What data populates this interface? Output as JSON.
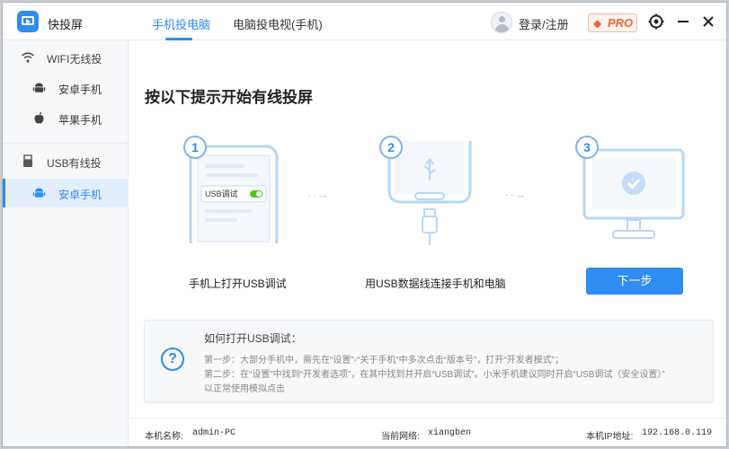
{
  "app": {
    "name": "快投屏"
  },
  "tabs": [
    {
      "label": "手机投电脑"
    },
    {
      "label": "电脑投电视(手机)"
    }
  ],
  "header": {
    "login_label": "登录/注册",
    "pro_label": "PRO"
  },
  "sidebar": {
    "sections": [
      {
        "label": "WIFI无线投",
        "items": [
          {
            "label": "安卓手机"
          },
          {
            "label": "苹果手机"
          }
        ]
      },
      {
        "label": "USB有线投",
        "items": [
          {
            "label": "安卓手机"
          }
        ]
      }
    ]
  },
  "main": {
    "headline": "按以下提示开始有线投屏",
    "steps": [
      {
        "number": "1",
        "caption": "手机上打开USB调试",
        "phone_label": "USB调试"
      },
      {
        "number": "2",
        "caption": "用USB数据线连接手机和电脑"
      },
      {
        "number": "3"
      }
    ],
    "arrow": "··→",
    "next_button": "下一步",
    "help": {
      "icon": "?",
      "title": "如何打开USB调试：",
      "lines": [
        "第一步：大部分手机中，需先在“设置”-“关于手机”中多次点击“版本号”，打开“开发者模式”；",
        "第二步：在“设置”中找到“开发者选项”，在其中找到并开启“USB调试”。小米手机建议同时开启“USB调试（安全设置）”",
        "以正常使用模拟点击"
      ]
    }
  },
  "footer": {
    "pc_name_label": "本机名称:",
    "pc_name_value": "admin-PC",
    "network_label": "当前网络:",
    "network_value": "xiangben",
    "ip_label": "本机IP地址:",
    "ip_value": "192.168.0.119"
  },
  "colors": {
    "accent": "#2f8cf0",
    "pro": "#f0653b"
  }
}
